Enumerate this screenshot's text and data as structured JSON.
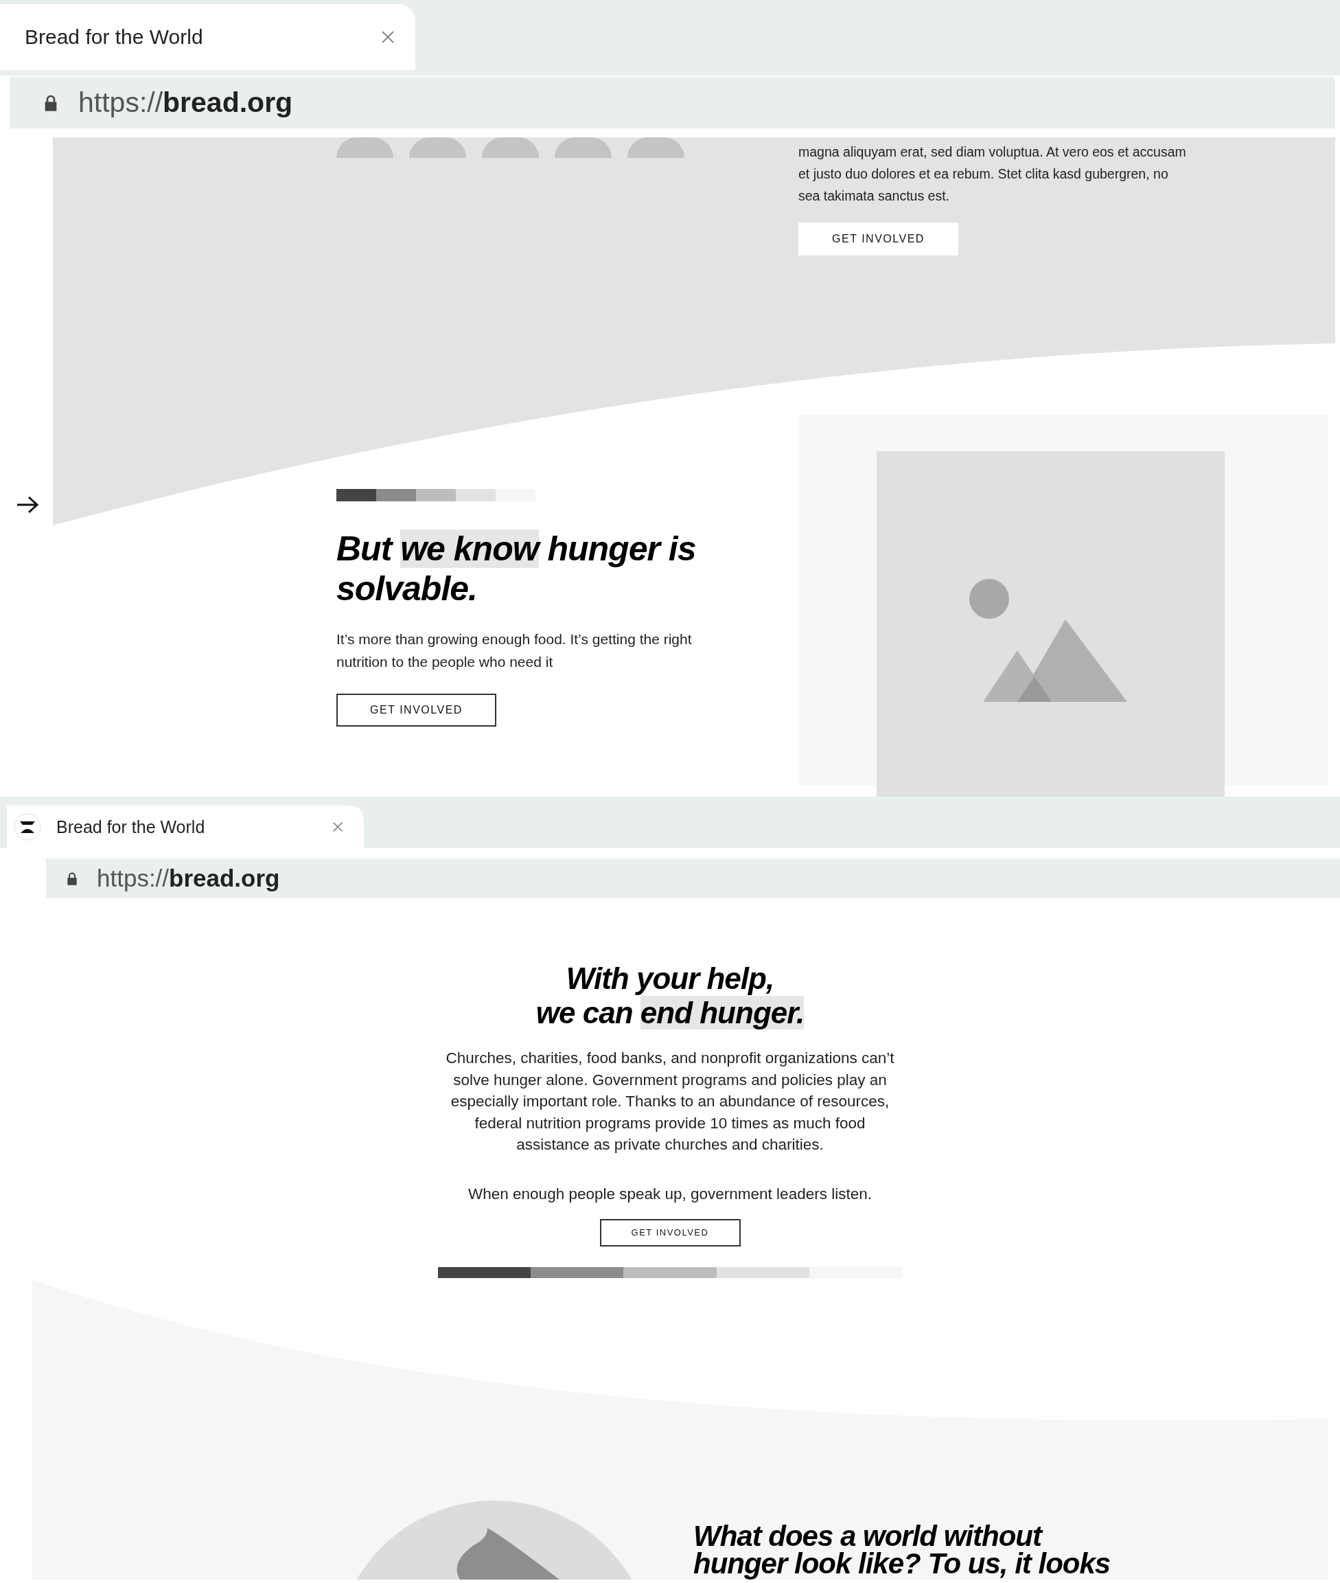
{
  "windows": [
    {
      "tab": {
        "title": "Bread for the World"
      },
      "address": "https://**bread.org**",
      "intro": {
        "text": "magna aliquyam erat, sed diam voluptua. At vero eos et accusam et justo duo dolores et ea rebum. Stet clita kasd gubergren, no sea takimata sanctus est.",
        "button": "GET INVOLVED"
      },
      "hero": {
        "heading": [
          {
            "text": "But ",
            "highlighted": false
          },
          {
            "text": "we know",
            "highlighted": true
          },
          {
            "text": " hunger is solvable.",
            "highlighted": false
          }
        ],
        "text": "It’s more than growing enough food. It’s getting the right nutrition to the people who need it",
        "button": "GET INVOLVED"
      }
    },
    {
      "tab": {
        "title": "Bread for the World"
      },
      "address": "https://**bread.org**",
      "help": {
        "heading": [
          {
            "text": "With your help,\nwe can ",
            "highlighted": false
          },
          {
            "text": "end hunger.",
            "highlighted": true
          }
        ],
        "paragraphs": [
          "Churches, charities, food banks, and nonprofit organizations can’t solve hunger alone. Government programs and policies play an especially important role. Thanks to an abundance of resources, federal nutrition programs provide 10 times as much food assistance as private churches and charities.",
          "When enough people speak up, government leaders listen."
        ],
        "button": "GET INVOLVED"
      },
      "world": {
        "heading": "What does a world without\nhunger look like? To us, it looks"
      }
    }
  ]
}
